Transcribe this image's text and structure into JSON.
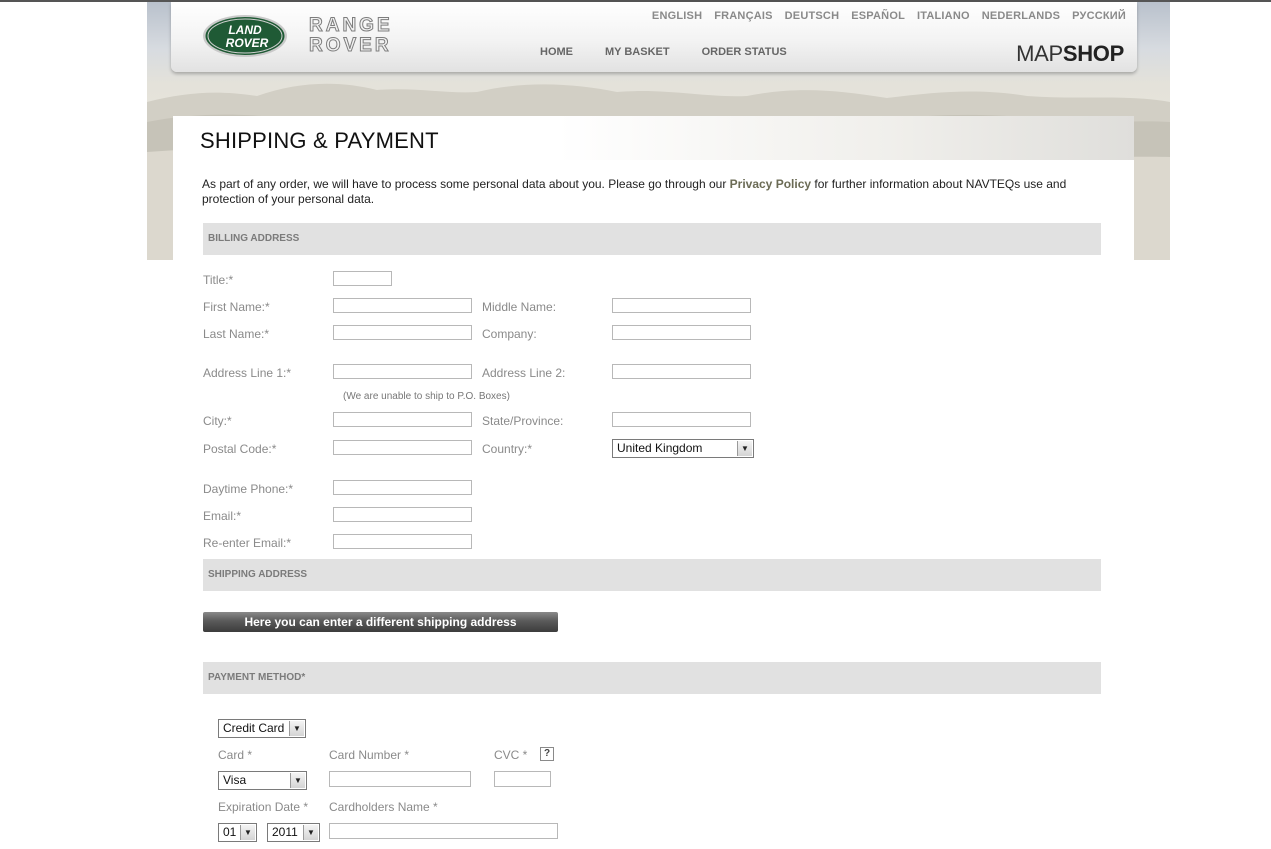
{
  "header": {
    "languages": [
      "ENGLISH",
      "FRANÇAIS",
      "DEUTSCH",
      "ESPAÑOL",
      "ITALIANO",
      "NEDERLANDS",
      "РУССКИЙ"
    ],
    "nav": [
      "HOME",
      "MY BASKET",
      "ORDER STATUS"
    ],
    "logo_text_top": "LAND",
    "logo_text_bottom": "ROVER",
    "brand_line1": "RANGE",
    "brand_line2": "ROVER",
    "mapshop_map": "MAP",
    "mapshop_shop": "SHOP"
  },
  "page": {
    "title": "SHIPPING & PAYMENT",
    "intro_before": "As part of any order, we will have to process some personal data about you. Please go through our ",
    "intro_link": "Privacy Policy",
    "intro_after": " for further information about NAVTEQs use and protection of your personal data."
  },
  "billing": {
    "header": "BILLING ADDRESS",
    "title_label": "Title:*",
    "first_name_label": "First Name:*",
    "middle_name_label": "Middle Name:",
    "last_name_label": "Last Name:*",
    "company_label": "Company:",
    "address1_label": "Address Line 1:*",
    "address2_label": "Address Line 2:",
    "po_note": "(We are unable to ship to P.O. Boxes)",
    "city_label": "City:*",
    "state_label": "State/Province:",
    "postal_label": "Postal Code:*",
    "country_label": "Country:*",
    "country_value": "United Kingdom",
    "phone_label": "Daytime Phone:*",
    "email_label": "Email:*",
    "reemail_label": "Re-enter Email:*"
  },
  "shipping": {
    "header": "SHIPPING ADDRESS",
    "button": "Here you can enter a different shipping address"
  },
  "payment": {
    "header": "PAYMENT METHOD*",
    "method_value": "Credit Card",
    "card_label": "Card *",
    "card_number_label": "Card Number *",
    "cvc_label": "CVC *",
    "cvc_help": "?",
    "card_value": "Visa",
    "expiration_label": "Expiration Date *",
    "cardholder_label": "Cardholders Name *",
    "exp_month": "01",
    "exp_year": "2011"
  },
  "colors": {
    "section_bg": "#e1e1e1",
    "button_dark": "#3c3c3c",
    "logo_green": "#1f5a35"
  }
}
